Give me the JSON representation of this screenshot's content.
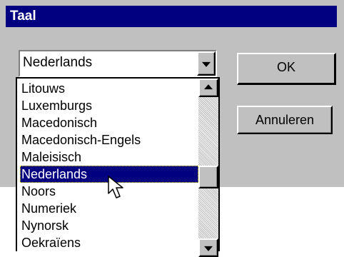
{
  "window": {
    "title": "Taal"
  },
  "language_combo": {
    "selected": "Nederlands"
  },
  "language_list": {
    "items": [
      {
        "label": "Litouws",
        "selected": false
      },
      {
        "label": "Luxemburgs",
        "selected": false
      },
      {
        "label": "Macedonisch",
        "selected": false
      },
      {
        "label": "Macedonisch-Engels",
        "selected": false
      },
      {
        "label": "Maleisisch",
        "selected": false
      },
      {
        "label": "Nederlands",
        "selected": true
      },
      {
        "label": "Noors",
        "selected": false
      },
      {
        "label": "Numeriek",
        "selected": false
      },
      {
        "label": "Nynorsk",
        "selected": false
      },
      {
        "label": "Oekraïens",
        "selected": false
      }
    ]
  },
  "buttons": {
    "ok": "OK",
    "cancel": "Annuleren"
  },
  "colors": {
    "titlebar": "#000080",
    "dialog_face": "#c0c0c0",
    "selection": "#000080"
  },
  "icons": {
    "combo_arrow": "chevron-down-icon",
    "scroll_up": "arrow-up-icon",
    "scroll_down": "arrow-down-icon",
    "cursor": "mouse-pointer-icon"
  }
}
